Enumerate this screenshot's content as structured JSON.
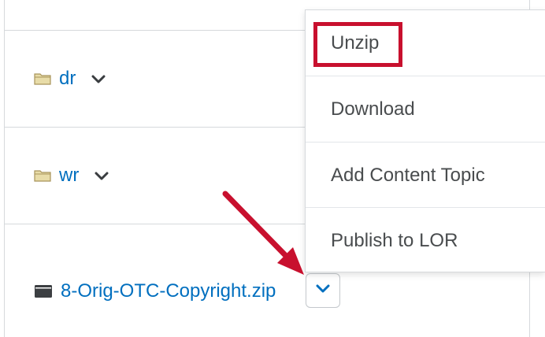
{
  "items": [
    {
      "name": "dr",
      "icon": "folder-icon"
    },
    {
      "name": "wr",
      "icon": "folder-icon"
    },
    {
      "name": "8-Orig-OTC-Copyright.zip",
      "icon": "archive-file-icon"
    }
  ],
  "menu": {
    "items": [
      "Unzip",
      "Download",
      "Add Content Topic",
      "Publish to LOR"
    ]
  },
  "colors": {
    "link": "#006fbf",
    "menu_text": "#494c4e",
    "annotation": "#c8102e",
    "folder": "#d9c98a"
  }
}
